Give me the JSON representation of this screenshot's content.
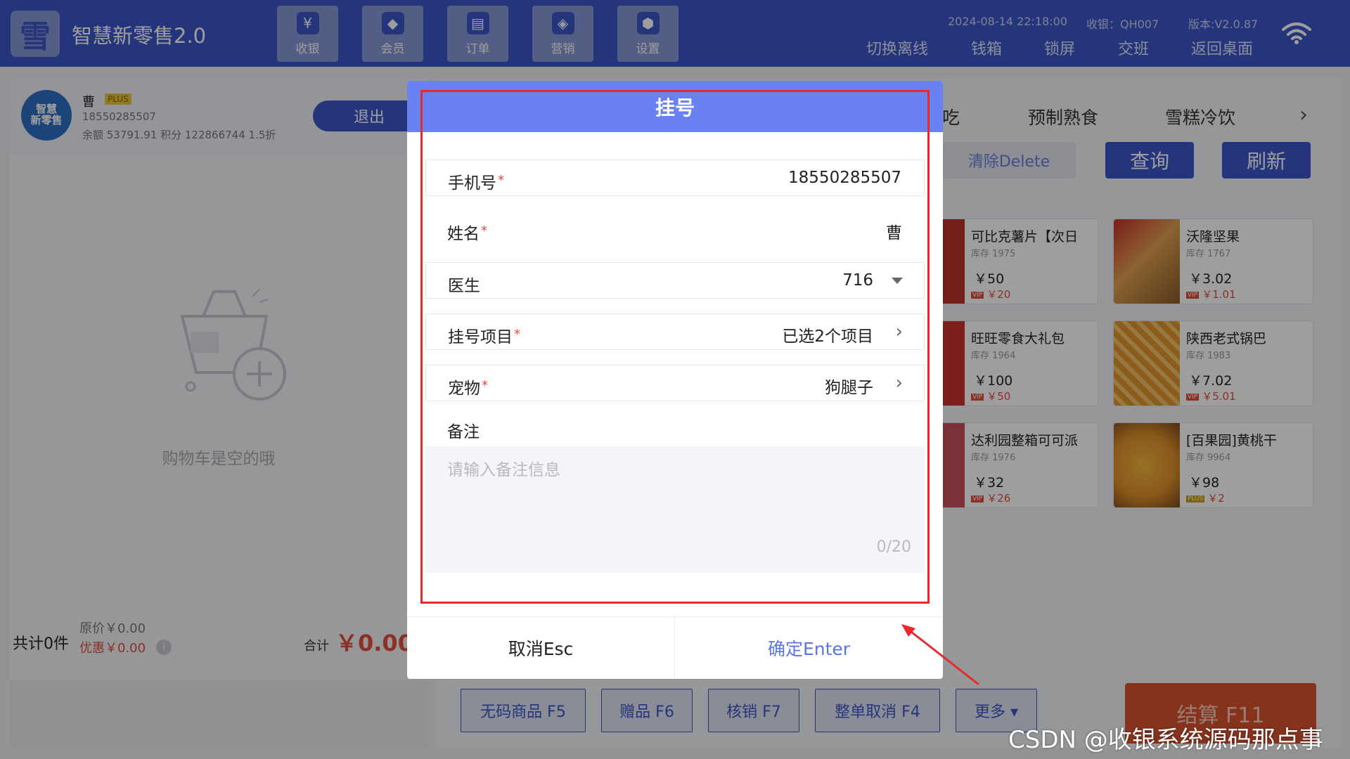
{
  "app": {
    "title": "智慧新零售2.0",
    "logo_icon": "logo-icon"
  },
  "nav": [
    {
      "label": "收银",
      "icon": "cashier-icon",
      "glyph": "¥"
    },
    {
      "label": "会员",
      "icon": "diamond-icon",
      "glyph": "◆"
    },
    {
      "label": "订单",
      "icon": "order-icon",
      "glyph": "▤"
    },
    {
      "label": "营销",
      "icon": "tag-icon",
      "glyph": "◈"
    },
    {
      "label": "设置",
      "icon": "gear-icon",
      "glyph": "⬢"
    }
  ],
  "status": {
    "datetime": "2024-08-14 22:18:00",
    "cashier": "收银：QH007",
    "version": "版本:V2.0.87"
  },
  "top_links": [
    "切换离线",
    "钱箱",
    "锁屏",
    "交班",
    "返回桌面"
  ],
  "member": {
    "name": "曹",
    "badge": "PLUS",
    "phone": "18550285507",
    "balance_line": "余额 53791.91   积分 122866744   1.5折",
    "logout_label": "退出",
    "avatar_text": "智慧\n新零售"
  },
  "cart": {
    "empty_text": "购物车是空的哦",
    "count_label": "共计0件",
    "original_price": "原价￥0.00",
    "discount": "优惠￥0.00",
    "info_glyph": "i",
    "sum_label": "合计",
    "sum_value": "￥0.00"
  },
  "categories": [
    "吃",
    "预制熟食",
    "雪糕冷饮"
  ],
  "category_next_glyph": "›",
  "toolbar": {
    "clear_label": "清除Delete",
    "query_label": "查询",
    "refresh_label": "刷新"
  },
  "products": [
    {
      "name": "可比克薯片【次日",
      "stock": "库存 1975",
      "price": "￥50",
      "vip_tag": "VIP",
      "vip_price": "￥20",
      "color": "#b8322a"
    },
    {
      "name": "沃隆坚果",
      "stock": "库存 1767",
      "price": "￥3.02",
      "vip_tag": "VIP",
      "vip_price": "￥1.01",
      "color": "#c98a3a"
    },
    {
      "name": "旺旺零食大礼包",
      "stock": "库存 1964",
      "price": "￥100",
      "vip_tag": "VIP",
      "vip_price": "￥50",
      "color": "#c8332b"
    },
    {
      "name": "陕西老式锅巴",
      "stock": "库存 1983",
      "price": "￥7.02",
      "vip_tag": "VIP",
      "vip_price": "￥5.01",
      "color": "#e0952d"
    },
    {
      "name": "达利园整箱可可派",
      "stock": "库存 1976",
      "price": "￥32",
      "vip_tag": "VIP",
      "vip_price": "￥26",
      "color": "#b43b47"
    },
    {
      "name": "[百果园]黄桃干",
      "stock": "库存 9964",
      "price": "￥98",
      "vip_tag": "PLUS",
      "vip_price": "￥2",
      "color": "#e8a030"
    }
  ],
  "bottom_actions": [
    "无码商品  F5",
    "赠品  F6",
    "核销  F7",
    "整单取消  F4",
    "更多 ▾"
  ],
  "checkout_label": "结算 F11",
  "watermark": "CSDN @收银系统源码那点事",
  "modal": {
    "title": "挂号",
    "phone_label": "手机号",
    "phone_value": "18550285507",
    "name_label": "姓名",
    "name_value": "曹",
    "doctor_label": "医生",
    "doctor_value": "716",
    "item_label": "挂号项目",
    "item_value": "已选2个项目",
    "pet_label": "宠物",
    "pet_value": "狗腿子",
    "remark_label": "备注",
    "remark_placeholder": "请输入备注信息",
    "remark_count": "0/20",
    "required_mark": "*",
    "arrow_glyph": "›",
    "cancel_label": "取消Esc",
    "confirm_label": "确定Enter"
  },
  "colors": {
    "primary": "#3d56c9",
    "modal_header": "#6a82f1",
    "highlight": "#e8282b",
    "danger": "#e24e3c"
  }
}
